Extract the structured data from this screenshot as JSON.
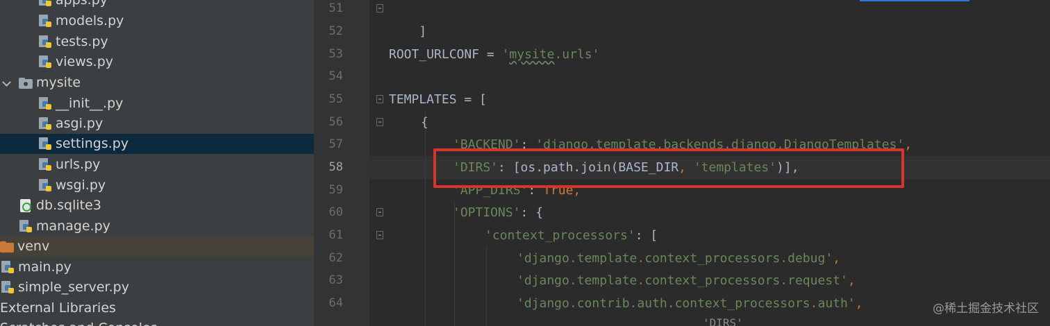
{
  "project_tree": {
    "items": [
      {
        "label": "apps.py",
        "icon": "python-file-icon"
      },
      {
        "label": "models.py",
        "icon": "python-file-icon"
      },
      {
        "label": "tests.py",
        "icon": "python-file-icon"
      },
      {
        "label": "views.py",
        "icon": "python-file-icon"
      },
      {
        "label": "mysite",
        "icon": "package-folder-icon"
      },
      {
        "label": "__init__.py",
        "icon": "python-file-icon"
      },
      {
        "label": "asgi.py",
        "icon": "python-file-icon"
      },
      {
        "label": "settings.py",
        "icon": "python-file-icon",
        "selected": true
      },
      {
        "label": "urls.py",
        "icon": "python-file-icon"
      },
      {
        "label": "wsgi.py",
        "icon": "python-file-icon"
      },
      {
        "label": "db.sqlite3",
        "icon": "database-file-icon"
      },
      {
        "label": "manage.py",
        "icon": "python-file-icon"
      },
      {
        "label": "venv",
        "icon": "excluded-folder-icon"
      },
      {
        "label": "main.py",
        "icon": "python-file-icon"
      },
      {
        "label": "simple_server.py",
        "icon": "python-file-icon"
      },
      {
        "label": "External Libraries",
        "icon": ""
      },
      {
        "label": "Scratches and Consoles",
        "icon": ""
      }
    ]
  },
  "editor": {
    "line_numbers": [
      "51",
      "52",
      "53",
      "54",
      "55",
      "56",
      "57",
      "58",
      "59",
      "60",
      "61",
      "62",
      "63",
      "64"
    ],
    "current_line": "58",
    "lines": {
      "l51": {
        "a": "]"
      },
      "l53": {
        "a": "ROOT_URLCONF ",
        "b": "= ",
        "q1": "'",
        "w": "mysite",
        "q2": ".urls'"
      },
      "l55": {
        "a": "TEMPLATES ",
        "b": "= ["
      },
      "l56": {
        "a": "{"
      },
      "l57": {
        "k": "'BACKEND'",
        "c": ": ",
        "v": "'django.template.backends.django.DjangoTemplates'",
        "e": ","
      },
      "l58": {
        "k": "'DIRS'",
        "c": ": [os.path.join(BASE_DIR",
        "m": ", ",
        "v": "'templates'",
        "e": ")],"
      },
      "l59": {
        "k": "'APP_DIRS'",
        "c": ": ",
        "v": "True",
        "e": ","
      },
      "l60": {
        "k": "'OPTIONS'",
        "c": ": {"
      },
      "l61": {
        "k": "'context_processors'",
        "c": ": ["
      },
      "l62": {
        "v": "'django.template.context_processors.debug'",
        "e": ","
      },
      "l63": {
        "v": "'django.template.context_processors.request'",
        "e": ","
      },
      "l64": {
        "v": "'django.contrib.auth.context_processors.auth'",
        "e": ","
      }
    },
    "breadcrumb": "'DIRS'"
  },
  "watermark": "@稀土掘金技术社区",
  "colors": {
    "sidebar_bg": "#3c3f41",
    "editor_bg": "#2b2b2b",
    "selected_row": "#0d293e",
    "string": "#6a8759",
    "operator": "#cc7832",
    "identifier": "#a9b7c6",
    "highlight_box": "#d9342b"
  }
}
